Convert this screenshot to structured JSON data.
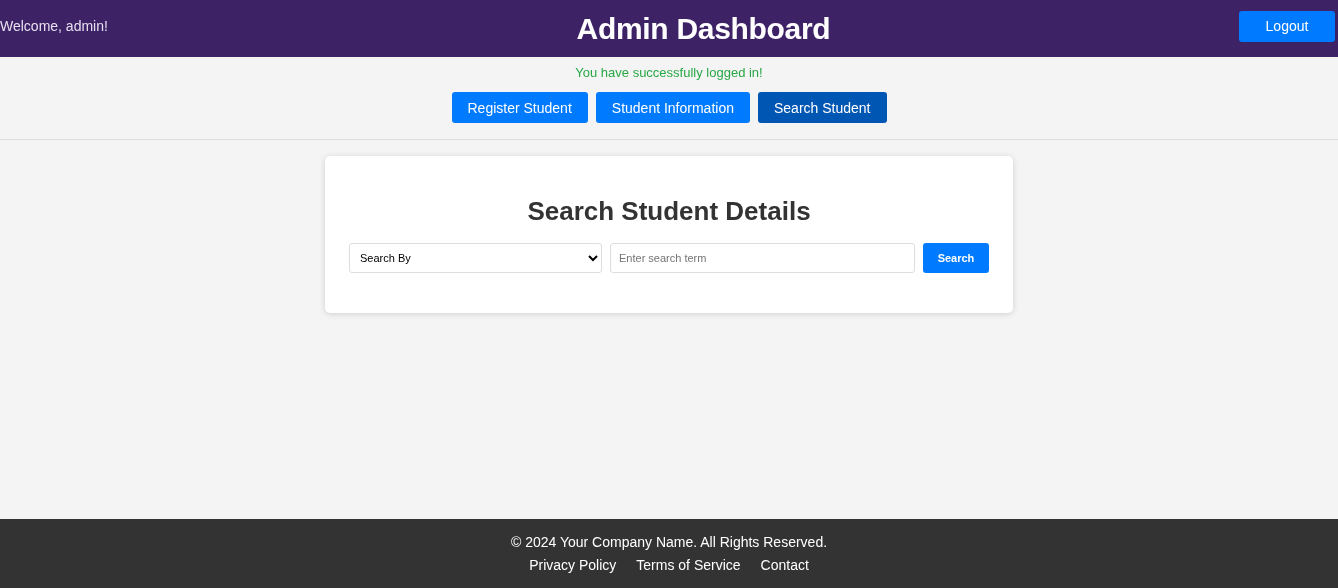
{
  "header": {
    "welcome": "Welcome, admin!",
    "title": "Admin Dashboard",
    "logout": "Logout"
  },
  "message": "You have successfully logged in!",
  "nav": [
    {
      "label": "Register Student",
      "selected": false
    },
    {
      "label": "Student Information",
      "selected": false
    },
    {
      "label": "Search Student",
      "selected": true
    }
  ],
  "search": {
    "heading": "Search Student Details",
    "search_by": "Search By",
    "placeholder": "Enter search term",
    "button": "Search"
  },
  "footer": {
    "copyright": "© 2024 Your Company Name. All Rights Reserved.",
    "links": [
      "Privacy Policy",
      "Terms of Service",
      "Contact"
    ]
  }
}
